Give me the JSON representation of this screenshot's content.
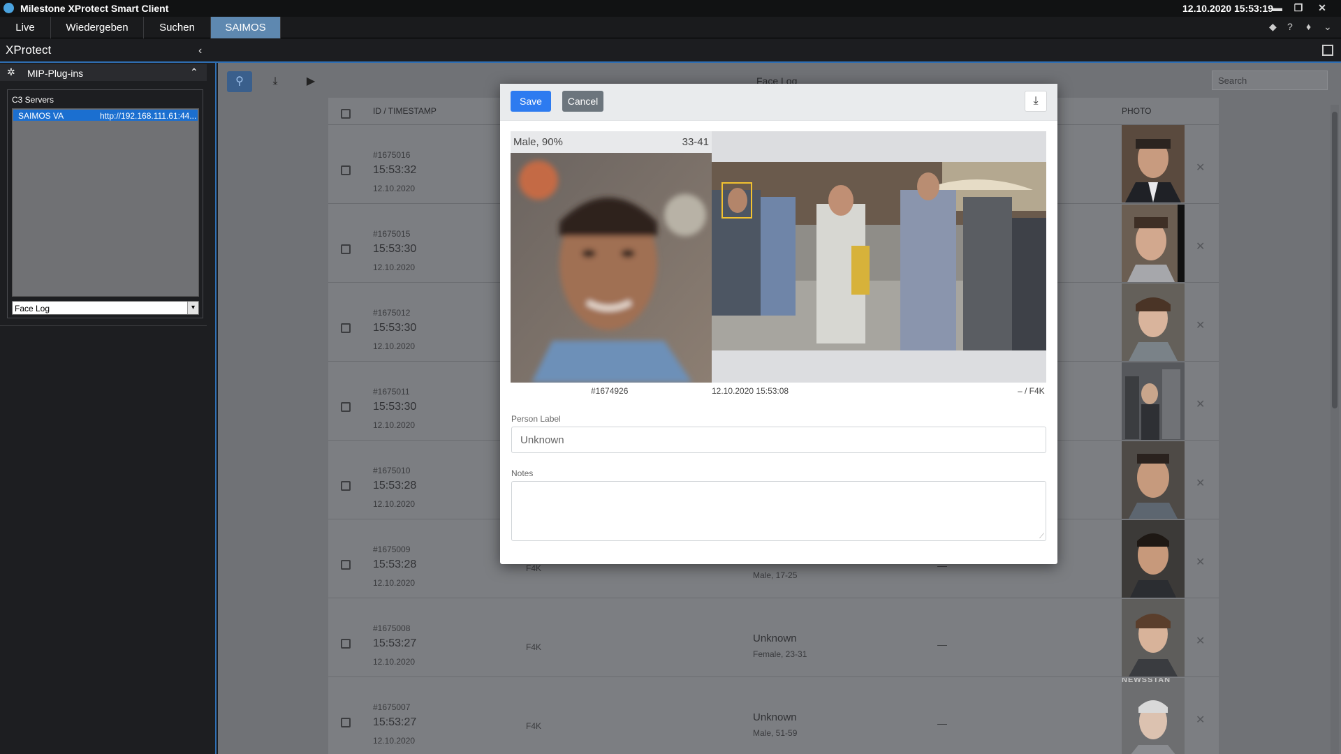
{
  "window": {
    "app_title": "Milestone XProtect Smart Client",
    "clock": "12.10.2020 15:53:19"
  },
  "tabs": [
    {
      "label": "Live"
    },
    {
      "label": "Wiedergeben"
    },
    {
      "label": "Suchen"
    },
    {
      "label": "SAIMOS"
    }
  ],
  "sidebar": {
    "title": "XProtect",
    "section": "MIP-Plug-ins",
    "panel_title": "C3 Servers",
    "server_name": "SAIMOS VA",
    "server_url": "http://192.168.111.61:44...",
    "view_select": "Face Log"
  },
  "main": {
    "page_title": "Face Log",
    "search_placeholder": "Search",
    "headers": {
      "id_ts": "ID / TIMESTAMP",
      "photo": "PHOTO"
    },
    "rows": [
      {
        "id": "#1675016",
        "time": "15:53:32",
        "date": "12.10.2020",
        "source": "",
        "name": "",
        "sub": "",
        "dash": ""
      },
      {
        "id": "#1675015",
        "time": "15:53:30",
        "date": "12.10.2020",
        "source": "",
        "name": "",
        "sub": "",
        "dash": ""
      },
      {
        "id": "#1675012",
        "time": "15:53:30",
        "date": "12.10.2020",
        "source": "",
        "name": "",
        "sub": "",
        "dash": ""
      },
      {
        "id": "#1675011",
        "time": "15:53:30",
        "date": "12.10.2020",
        "source": "",
        "name": "",
        "sub": "",
        "dash": ""
      },
      {
        "id": "#1675010",
        "time": "15:53:28",
        "date": "12.10.2020",
        "source": "",
        "name": "",
        "sub": "",
        "dash": ""
      },
      {
        "id": "#1675009",
        "time": "15:53:28",
        "date": "12.10.2020",
        "source": "F4K",
        "name": "",
        "sub": "Male, 17-25",
        "dash": "—"
      },
      {
        "id": "#1675008",
        "time": "15:53:27",
        "date": "12.10.2020",
        "source": "F4K",
        "name": "Unknown",
        "sub": "Female, 23-31",
        "dash": "—"
      },
      {
        "id": "#1675007",
        "time": "15:53:27",
        "date": "12.10.2020",
        "source": "F4K",
        "name": "Unknown",
        "sub": "Male, 51-59",
        "dash": "—"
      }
    ],
    "photo_watermark": "NEWSSTAN"
  },
  "modal": {
    "save_label": "Save",
    "cancel_label": "Cancel",
    "gender_conf": "Male, 90%",
    "age_range": "33-41",
    "detection_id": "#1674926",
    "detection_ts": "12.10.2020 15:53:08",
    "detection_src": "– / F4K",
    "person_label_caption": "Person Label",
    "person_label_placeholder": "Unknown",
    "notes_caption": "Notes"
  },
  "colors": {
    "accent": "#2f6fb3",
    "save_button": "#2d7bf0",
    "cancel_button": "#6c757d",
    "active_tab": "#5e88b0",
    "overlay": "#707276"
  }
}
